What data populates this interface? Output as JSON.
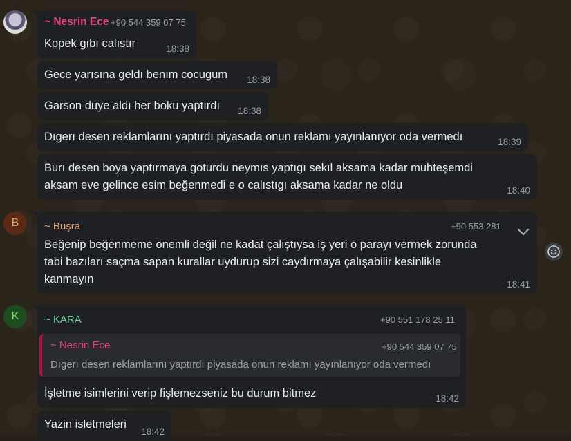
{
  "messages": [
    {
      "sender": "~ Nesrin Ece",
      "phone": "+90 544 359 07 75",
      "text": "Kopek gıbı calıstır",
      "time": "18:38"
    },
    {
      "text": "Gece yarısına geldı benım cocugum",
      "time": "18:38"
    },
    {
      "text": "Garson duye aldı her boku yaptırdı",
      "time": "18:38"
    },
    {
      "text": "Dıgerı desen reklamlarını yaptırdı piyasada onun reklamı yayınlanıyor oda vermedı",
      "time": "18:39"
    },
    {
      "line1": "Burı desen boya yaptırmaya goturdu neymıs yaptıgı sekıl aksama kadar muhteşemdi",
      "line2": "aksam eve gelince esim beğenmedi e o calıstıgı aksama kadar ne oldu",
      "time": "18:40"
    },
    {
      "sender": "~ Büşra",
      "phone": "+90 553 281",
      "line1": "Beğenip beğenmeme önemli değil ne kadat çalıştıysa iş yeri o parayı vermek zorunda",
      "line2": "tabi bazıları saçma sapan kurallar uydurup sizi caydırmaya çalışabilir kesinlikle",
      "line3": "kanmayın",
      "time": "18:41"
    },
    {
      "sender": "~ KARA",
      "phone": "+90 551 178 25 11",
      "quote_sender": "~ Nesrin Ece",
      "quote_phone": "+90 544 359 07 75",
      "quote_text": "Dıgerı desen reklamlarını yaptırdı piyasada onun reklamı yayınlanıyor oda vermedı",
      "text": "İşletme isimlerini verip fişlemezseniz bu durum bitmez",
      "time": "18:42"
    },
    {
      "text": "Yazin isletmeleri",
      "time": "18:42"
    }
  ],
  "avatars": {
    "b": "B",
    "k": "K"
  },
  "colors": {
    "nesrin": "#e0457b",
    "busra": "#e0a97a",
    "kara": "#6fd6a0",
    "bubble": "#1f2023",
    "background": "#2a241b"
  },
  "icons": {
    "emoji": "emoji-icon",
    "chevron": "chevron-down-icon"
  }
}
